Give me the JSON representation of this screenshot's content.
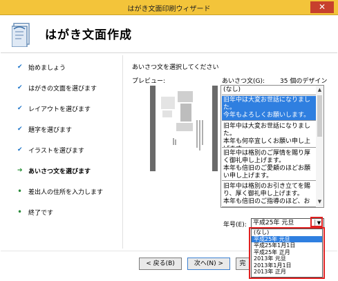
{
  "window": {
    "title": "はがき文面印刷ウィザード",
    "close_label": "✕"
  },
  "header": {
    "title": "はがき文面作成"
  },
  "steps": [
    {
      "label": "始めましょう",
      "state": "done"
    },
    {
      "label": "はがきの文面を選びます",
      "state": "done"
    },
    {
      "label": "レイアウトを選びます",
      "state": "done"
    },
    {
      "label": "題字を選びます",
      "state": "done"
    },
    {
      "label": "イラストを選びます",
      "state": "done"
    },
    {
      "label": "あいさつ文を選びます",
      "state": "current"
    },
    {
      "label": "差出人の住所を入力します",
      "state": "pending"
    },
    {
      "label": "終了です",
      "state": "pending"
    }
  ],
  "step_marks": {
    "done": "✔",
    "current": "➔",
    "pending": "•"
  },
  "main": {
    "instruction": "あいさつ文を選択してください",
    "preview_label": "プレビュー:",
    "greeting_label": "あいさつ文(G):",
    "design_count": "35 個のデザイン",
    "greetings": [
      {
        "text": "(なし)",
        "selected": false
      },
      {
        "text": "旧年中は大変お世話になりました。\n今年もよろしくお願いします。",
        "selected": true
      },
      {
        "text": "旧年中は大変お世話になりました。\n本年も何卒宜しくお願い申し上げます。",
        "selected": false
      },
      {
        "text": "旧年中は格別のご厚情を賜り厚く御礼申し上げます。\n本年も倍旧のご愛顧のほどお願い申し上げます。",
        "selected": false
      },
      {
        "text": "旧年中は格別のお引き立てを賜り、厚く御礼申し上げます。\n本年も倍旧のご指導のほど、お",
        "selected": false
      }
    ],
    "year_label": "年号(E):",
    "year_value": "平成25年 元旦",
    "year_options": [
      {
        "label": "(なし)",
        "selected": false
      },
      {
        "label": "平成25年 元旦",
        "selected": true
      },
      {
        "label": "平成25年1月1日",
        "selected": false
      },
      {
        "label": "平成25年 正月",
        "selected": false
      },
      {
        "label": "2013年 元旦",
        "selected": false
      },
      {
        "label": "2013年1月1日",
        "selected": false
      },
      {
        "label": "2013年 正月",
        "selected": false
      }
    ]
  },
  "footer": {
    "back_label": "< 戻る(B)",
    "next_label": "次へ(N) >",
    "finish_label": "完"
  },
  "colors": {
    "titlebar": "#f3c43a",
    "selection": "#2f7fe0",
    "highlight": "#e02020",
    "close": "#c7402d"
  }
}
